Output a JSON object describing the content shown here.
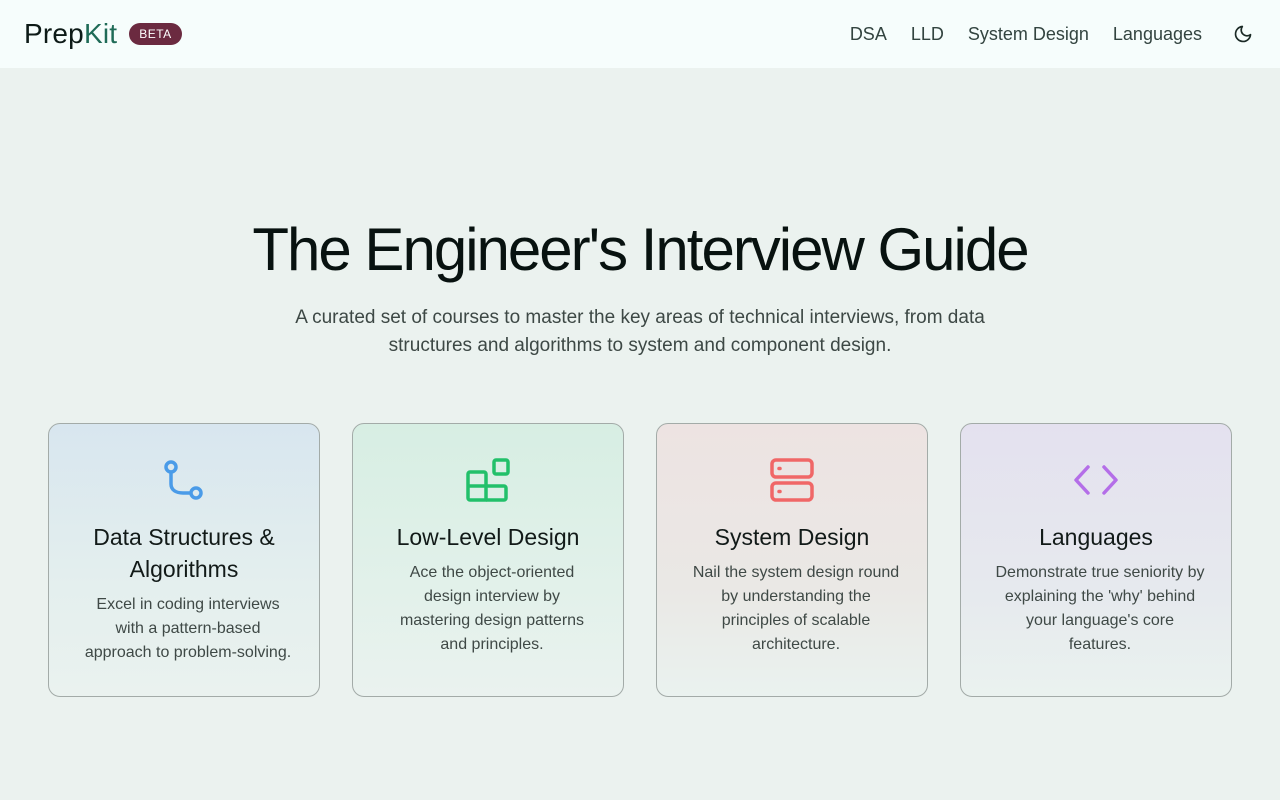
{
  "header": {
    "logo_part1": "Prep",
    "logo_part2": "Kit",
    "badge": "BETA",
    "nav": [
      {
        "label": "DSA"
      },
      {
        "label": "LLD"
      },
      {
        "label": "System Design"
      },
      {
        "label": "Languages"
      }
    ],
    "theme_icon": "moon-icon"
  },
  "hero": {
    "title": "The Engineer's Interview Guide",
    "subtitle": "A curated set of courses to master the key areas of technical interviews, from data structures and algorithms to system and component design."
  },
  "cards": [
    {
      "title": "Data Structures & Algorithms",
      "description": "Excel in coding interviews with a pattern-based approach to problem-solving.",
      "icon": "git-branch-icon",
      "color": "#4a9be8"
    },
    {
      "title": "Low-Level Design",
      "description": "Ace the object-oriented design interview by mastering design patterns and principles.",
      "icon": "blocks-icon",
      "color": "#22c06a"
    },
    {
      "title": "System Design",
      "description": "Nail the system design round by understanding the principles of scalable architecture.",
      "icon": "server-icon",
      "color": "#f06767"
    },
    {
      "title": "Languages",
      "description": "Demonstrate true seniority by explaining the 'why' behind your language's core features.",
      "icon": "code-icon",
      "color": "#b46ee8"
    }
  ]
}
